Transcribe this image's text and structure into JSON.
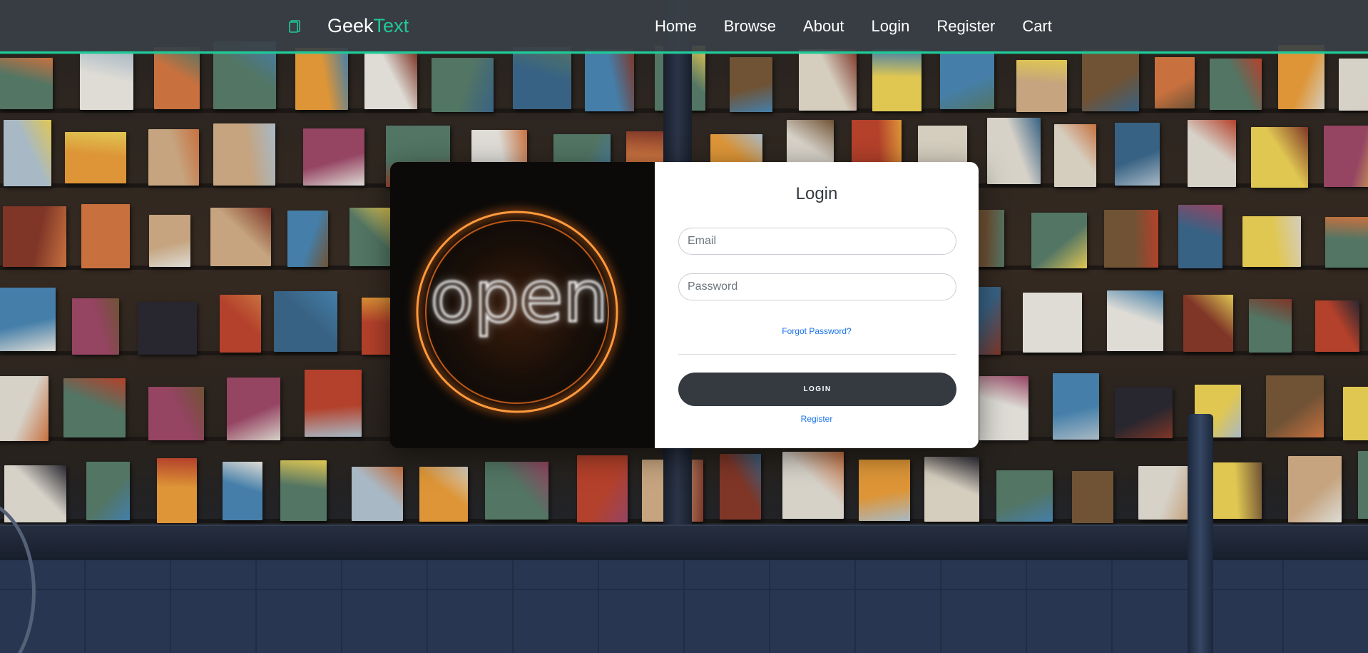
{
  "navbar": {
    "brand_part1": "Geek",
    "brand_part2": "Text",
    "brand_icon": "book-icon",
    "links": [
      "Home",
      "Browse",
      "About",
      "Login",
      "Register",
      "Cart"
    ]
  },
  "hero_image": {
    "sign_text": "open"
  },
  "login_form": {
    "title": "Login",
    "email_placeholder": "Email",
    "password_placeholder": "Password",
    "forgot_label": "Forgot Password?",
    "login_button": "LOGIN",
    "register_label": "Register"
  },
  "colors": {
    "accent": "#20c997",
    "navbar_bg": "#3a4046",
    "button_bg": "#343a40",
    "link": "#1a73e8",
    "neon": "#ff8a2a"
  }
}
